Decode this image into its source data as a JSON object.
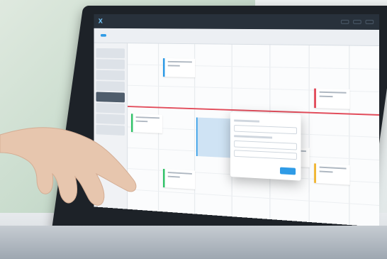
{
  "app": {
    "logo": "X"
  },
  "colors": {
    "accent": "#2f9be6",
    "event_green": "#34c36b",
    "event_yellow": "#f1b530",
    "event_red": "#e24b5a",
    "topbar": "#28313b"
  },
  "icons": {
    "logo": "app-logo-icon"
  }
}
